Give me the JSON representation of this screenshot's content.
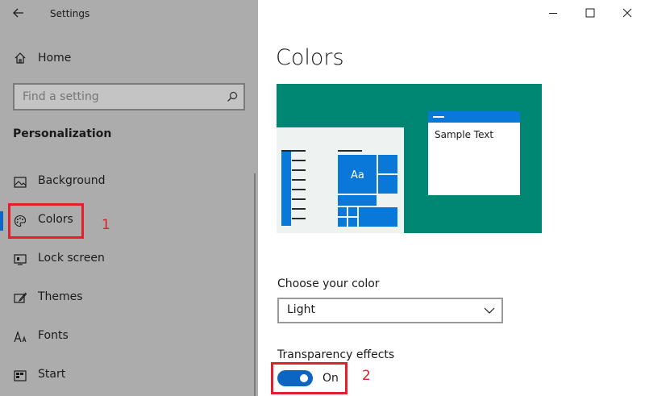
{
  "window": {
    "title": "Settings",
    "back_icon": "back-arrow-icon",
    "minimize_icon": "minimize-icon",
    "maximize_icon": "maximize-icon",
    "close_icon": "close-icon"
  },
  "sidebar": {
    "home_label": "Home",
    "search": {
      "placeholder": "Find a setting",
      "icon": "search-icon"
    },
    "section_title": "Personalization",
    "items": [
      {
        "label": "Background",
        "icon": "picture-icon"
      },
      {
        "label": "Colors",
        "icon": "palette-icon",
        "selected": true
      },
      {
        "label": "Lock screen",
        "icon": "lock-screen-icon"
      },
      {
        "label": "Themes",
        "icon": "brush-icon"
      },
      {
        "label": "Fonts",
        "icon": "font-icon"
      },
      {
        "label": "Start",
        "icon": "start-icon"
      }
    ]
  },
  "main": {
    "page_title": "Colors",
    "preview": {
      "sample_text": "Sample Text",
      "tile_label": "Aa",
      "accent_color": "#008774",
      "tile_color": "#0a78d8"
    },
    "choose_color": {
      "label": "Choose your color",
      "value": "Light",
      "icon": "chevron-down-icon"
    },
    "transparency": {
      "label": "Transparency effects",
      "state": "On",
      "enabled": true
    }
  },
  "annotations": {
    "colors_marker": "1",
    "toggle_marker": "2",
    "color": "#e0202a"
  }
}
